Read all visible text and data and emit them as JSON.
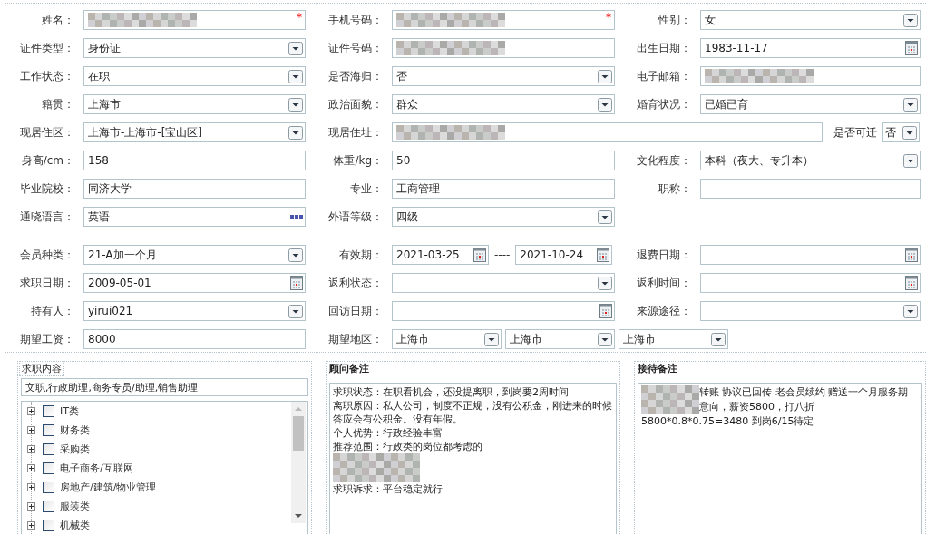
{
  "sections": [
    {
      "rows": [
        {
          "cells": [
            {
              "label": "姓名：",
              "fields": [
                {
                  "kind": "text",
                  "redacted": true,
                  "required_mark": "*"
                }
              ]
            },
            {
              "label": "手机号码：",
              "fields": [
                {
                  "kind": "text",
                  "redacted": true,
                  "required_mark": "*"
                }
              ]
            },
            {
              "label": "性别：",
              "fields": [
                {
                  "kind": "select",
                  "value": "女"
                }
              ]
            }
          ]
        },
        {
          "cells": [
            {
              "label": "证件类型：",
              "fields": [
                {
                  "kind": "select",
                  "value": "身份证"
                }
              ]
            },
            {
              "label": "证件号码：",
              "fields": [
                {
                  "kind": "text",
                  "redacted": true
                }
              ]
            },
            {
              "label": "出生日期：",
              "fields": [
                {
                  "kind": "date",
                  "value": "1983-11-17"
                }
              ]
            }
          ]
        },
        {
          "cells": [
            {
              "label": "工作状态：",
              "fields": [
                {
                  "kind": "select",
                  "value": "在职"
                }
              ]
            },
            {
              "label": "是否海归：",
              "fields": [
                {
                  "kind": "select",
                  "value": "否"
                }
              ]
            },
            {
              "label": "电子邮箱：",
              "fields": [
                {
                  "kind": "text",
                  "redacted": true
                }
              ]
            }
          ]
        },
        {
          "cells": [
            {
              "label": "籍贯：",
              "fields": [
                {
                  "kind": "select",
                  "value": "上海市"
                }
              ]
            },
            {
              "label": "政治面貌：",
              "fields": [
                {
                  "kind": "select",
                  "value": "群众"
                }
              ]
            },
            {
              "label": "婚育状况：",
              "fields": [
                {
                  "kind": "select",
                  "value": "已婚已育"
                }
              ]
            }
          ]
        },
        {
          "cells": [
            {
              "label": "现居住区：",
              "fields": [
                {
                  "kind": "select",
                  "value": "上海市-上海市-[宝山区]"
                }
              ]
            },
            {
              "label": "现居住址：",
              "fields": [
                {
                  "kind": "text",
                  "redacted": true
                }
              ],
              "trailing": {
                "label": "是否可迁",
                "field": {
                  "kind": "select",
                  "value": "否"
                }
              }
            }
          ]
        },
        {
          "cells": [
            {
              "label": "身高/cm：",
              "fields": [
                {
                  "kind": "text",
                  "value": "158"
                }
              ]
            },
            {
              "label": "体重/kg：",
              "fields": [
                {
                  "kind": "text",
                  "value": "50"
                }
              ]
            },
            {
              "label": "文化程度：",
              "fields": [
                {
                  "kind": "select",
                  "value": "本科（夜大、专升本）"
                }
              ]
            }
          ]
        },
        {
          "cells": [
            {
              "label": "毕业院校：",
              "fields": [
                {
                  "kind": "text",
                  "value": "同济大学"
                }
              ]
            },
            {
              "label": "专业：",
              "fields": [
                {
                  "kind": "text",
                  "value": "工商管理"
                }
              ]
            },
            {
              "label": "职称：",
              "fields": [
                {
                  "kind": "text"
                }
              ]
            }
          ]
        },
        {
          "cells": [
            {
              "label": "通晓语言：",
              "fields": [
                {
                  "kind": "more",
                  "value": "英语"
                }
              ]
            },
            {
              "label": "外语等级：",
              "fields": [
                {
                  "kind": "select",
                  "value": "四级"
                }
              ]
            }
          ]
        }
      ]
    },
    {
      "rows": [
        {
          "cells": [
            {
              "label": "会员种类：",
              "fields": [
                {
                  "kind": "select",
                  "value": "21-A加一个月"
                }
              ]
            },
            {
              "label": "有效期：",
              "separator": "----",
              "fields": [
                {
                  "kind": "date",
                  "value": "2021-03-25"
                },
                {
                  "kind": "date",
                  "value": "2021-10-24"
                }
              ]
            },
            {
              "label": "退费日期：",
              "fields": [
                {
                  "kind": "date"
                }
              ]
            }
          ]
        },
        {
          "cells": [
            {
              "label": "求职日期：",
              "fields": [
                {
                  "kind": "date",
                  "value": "2009-05-01"
                }
              ]
            },
            {
              "label": "返利状态：",
              "fields": [
                {
                  "kind": "select"
                }
              ]
            },
            {
              "label": "返利时间：",
              "fields": [
                {
                  "kind": "date"
                }
              ]
            }
          ]
        },
        {
          "cells": [
            {
              "label": "持有人：",
              "fields": [
                {
                  "kind": "select",
                  "value": "yirui021"
                }
              ]
            },
            {
              "label": "回访日期：",
              "fields": [
                {
                  "kind": "date"
                }
              ]
            },
            {
              "label": "来源途径：",
              "fields": [
                {
                  "kind": "select"
                }
              ]
            }
          ]
        },
        {
          "cells": [
            {
              "label": "期望工资：",
              "fields": [
                {
                  "kind": "text",
                  "value": "8000"
                }
              ]
            },
            {
              "label": "期望地区：",
              "fields": [
                {
                  "kind": "select",
                  "value": "上海市"
                },
                {
                  "kind": "select",
                  "value": "上海市"
                },
                {
                  "kind": "select",
                  "value": "上海市"
                }
              ]
            }
          ]
        }
      ]
    }
  ],
  "panels": [
    {
      "kind": "tree",
      "title": "求职内容",
      "title_bold": false,
      "summary": "文职,行政助理,商务专员/助理,销售助理",
      "items": [
        {
          "label": "IT类",
          "checked": false,
          "expanded": false
        },
        {
          "label": "财务类",
          "checked": false,
          "expanded": false
        },
        {
          "label": "采购类",
          "checked": false,
          "expanded": false
        },
        {
          "label": "电子商务/互联网",
          "checked": false,
          "expanded": false
        },
        {
          "label": "房地产/建筑/物业管理",
          "checked": false,
          "expanded": false
        },
        {
          "label": "服装类",
          "checked": false,
          "expanded": false
        },
        {
          "label": "机械类",
          "checked": false,
          "expanded": false
        }
      ]
    },
    {
      "kind": "notes",
      "title": "顾问备注",
      "title_bold": true,
      "lines": [
        {
          "kind": "text",
          "text": "求职状态：在职看机会，还没提离职，到岗要2周时间"
        },
        {
          "kind": "text",
          "text": "离职原因：私人公司，制度不正规，没有公积金，刚进来的时候答应会有公积金。没有年假。"
        },
        {
          "kind": "text",
          "text": "个人优势：行政经验丰富"
        },
        {
          "kind": "text",
          "text": "推荐范围：行政类的岗位都考虑的"
        },
        {
          "kind": "redacted"
        },
        {
          "kind": "redacted"
        },
        {
          "kind": "text",
          "text": "求职诉求：平台稳定就行"
        }
      ]
    },
    {
      "kind": "notes",
      "title": "接待备注",
      "title_bold": true,
      "lines": [
        {
          "kind": "text",
          "redacted_prefix": true,
          "text": " 转账 协议已回传 老会员续约 赠送一个月服务期"
        },
        {
          "kind": "text",
          "redacted_prefix": true,
          "text": "意向，薪资5800，打八折"
        },
        {
          "kind": "text",
          "text": "5800*0.8*0.75=3480  到岗6/15待定"
        }
      ]
    }
  ]
}
